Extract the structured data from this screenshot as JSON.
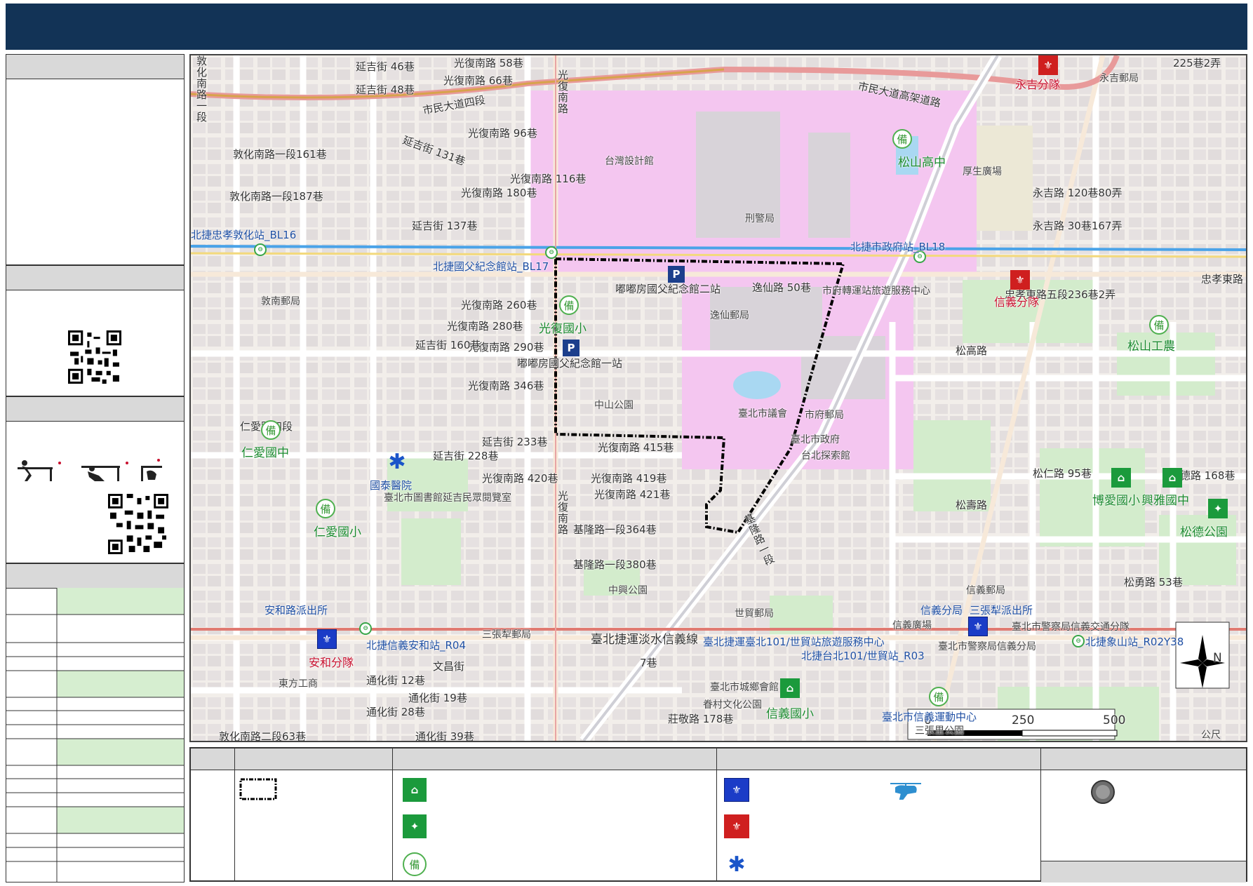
{
  "map": {
    "roads": {
      "freeway": "市民大道高架道路",
      "shimin_sec4": "市民大道四段",
      "zhongxiao_e": "忠孝東路",
      "keelung_sec1": "基隆路一段",
      "songgao": "松高路",
      "songshou": "松壽路",
      "renai_sec4": "仁愛路四段",
      "guangfu_s": "光復南路",
      "dunhua_s1": "敦化南路一段",
      "dunhua_s2_63": "敦化南路二段63巷",
      "xinyi_line": "臺北捷運淡水信義線"
    },
    "street_labels": [
      {
        "text": "光復南路 58巷"
      },
      {
        "text": "光復南路 66巷"
      },
      {
        "text": "光復南路 96巷"
      },
      {
        "text": "敦化南路一段161巷"
      },
      {
        "text": "敦化南路一段187巷"
      },
      {
        "text": "延吉街 131巷"
      },
      {
        "text": "延吉街 137巷"
      },
      {
        "text": "延吉街 46巷"
      },
      {
        "text": "延吉街 48巷"
      },
      {
        "text": "光復南路 116巷"
      },
      {
        "text": "光復南路 180巷"
      },
      {
        "text": "光復南路 260巷"
      },
      {
        "text": "光復南路 280巷"
      },
      {
        "text": "光復南路 290巷"
      },
      {
        "text": "光復南路 346巷"
      },
      {
        "text": "光復南路 415巷"
      },
      {
        "text": "光復南路 419巷"
      },
      {
        "text": "光復南路 421巷"
      },
      {
        "text": "光復南路 420巷"
      },
      {
        "text": "延吉街 160巷"
      },
      {
        "text": "延吉街 228巷"
      },
      {
        "text": "延吉街 233巷"
      },
      {
        "text": "基隆路一段364巷"
      },
      {
        "text": "基隆路一段380巷"
      },
      {
        "text": "逸仙路 50巷"
      },
      {
        "text": "忠孝東路五段236巷2弄"
      },
      {
        "text": "永吉路 120巷80弄"
      },
      {
        "text": "永吉路 30巷167弄"
      },
      {
        "text": "松仁路 95巷"
      },
      {
        "text": "松勇路 53巷"
      },
      {
        "text": "松德路 168巷"
      },
      {
        "text": "通化街 12巷"
      },
      {
        "text": "通化街 28巷"
      },
      {
        "text": "通化街 19巷"
      },
      {
        "text": "通化街 39巷"
      },
      {
        "text": "莊敬路 178巷"
      },
      {
        "text": "文昌街"
      },
      {
        "text": "7巷"
      },
      {
        "text": "225巷2弄"
      }
    ],
    "places": {
      "design_museum": "台灣設計館",
      "cib": "刑警局",
      "yongji_squad": "永吉分隊",
      "yongji_post": "永吉郵局",
      "songshan_hs": "松山高中",
      "housheng": "厚生廣場",
      "xinyi_squad": "信義分隊",
      "songshan_ind": "松山工農",
      "sun_yatsen_parking2": "嘟嘟房國父紀念館二站",
      "sun_yatsen_parking1": "嘟嘟房國父紀念館一站",
      "guangfu_es": "光復國小",
      "yixian_post": "逸仙郵局",
      "zhongshan_park": "中山公園",
      "council": "臺北市議會",
      "city_hall_post": "市府郵局",
      "city_hall": "臺北市政府",
      "explore_hall": "台北探索館",
      "transfer_center": "市府轉運站旅遊服務中心",
      "dunnan_post": "敦南郵局",
      "renai_jhs": "仁愛國中",
      "renai_es": "仁愛國小",
      "cathay": "國泰醫院",
      "library": "臺北市圖書館延吉民眾閱覽室",
      "zhongmin_park": "中興公園",
      "sanzhangli_post": "三張犁郵局",
      "anhe_police": "安和路派出所",
      "anhe_squad": "安和分隊",
      "dongfang": "東方工商",
      "xinyi_post": "信義郵局",
      "xinyi_branch": "信義分局",
      "sanzhangli_police": "三張犁派出所",
      "traffic_branch": "臺北市警察局信義交通分隊",
      "police_xinyi": "臺北市警察局信義分局",
      "xinyi_square": "信義廣場",
      "shimao_post": "世貿郵局",
      "t101_service": "臺北捷運臺北101/世貿站旅遊服務中心",
      "t101_station": "北捷台北101/世貿站_R03",
      "xiangshan": "北捷象山站_R02Y38",
      "anhe_station": "北捷信義安和站_R04",
      "sun_yatsen_station": "北捷國父紀念館站_BL17",
      "city_hall_station": "北捷市政府站_BL18",
      "dunhua_station": "北捷忠孝敦化站_BL16",
      "urban_rural": "臺北市城鄉會館",
      "juancun": "眷村文化公園",
      "xinyi_es": "信義國小",
      "xinyi_sports": "臺北市信義運動中心",
      "sanzhangli_park": "三張里公園",
      "boai_es": "博愛國小",
      "xingya_jhs": "興雅國中",
      "songde_park": "松德公園",
      "reserve_mark": "備"
    },
    "scale": {
      "ticks": [
        "0",
        "250",
        "500"
      ],
      "unit": "公尺"
    },
    "north": "N"
  },
  "legend": {
    "reserve_glyph": "備"
  },
  "colors": {
    "header": "#123356",
    "boundary": "#000000",
    "park_pink": "#f4c6f0",
    "mrt_blue": "#4aa3e8",
    "mrt_red": "#e07a72",
    "green_space": "#cfe8c7",
    "row_green": "#d6eed0"
  }
}
